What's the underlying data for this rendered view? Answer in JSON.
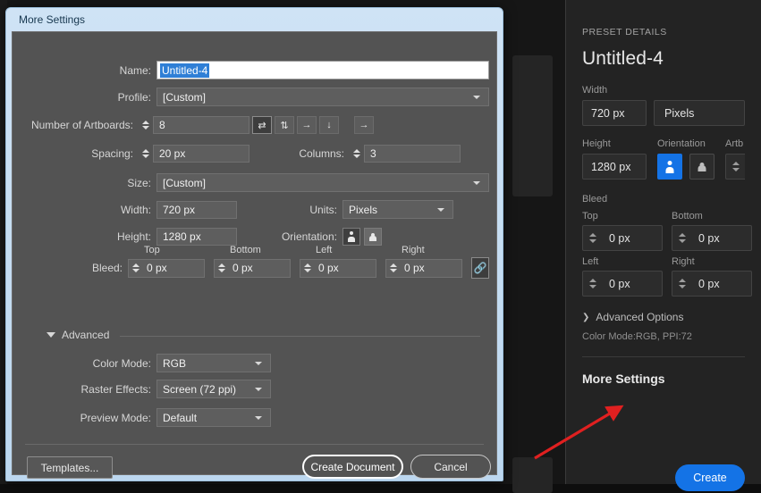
{
  "dialog": {
    "title": "More Settings",
    "fields": {
      "name_label": "Name:",
      "name_value": "Untitled-4",
      "profile_label": "Profile:",
      "profile_value": "[Custom]",
      "artboards_label": "Number of Artboards:",
      "artboards_value": "8",
      "spacing_label": "Spacing:",
      "spacing_value": "20 px",
      "columns_label": "Columns:",
      "columns_value": "3",
      "size_label": "Size:",
      "size_value": "[Custom]",
      "width_label": "Width:",
      "width_value": "720 px",
      "units_label": "Units:",
      "units_value": "Pixels",
      "height_label": "Height:",
      "height_value": "1280 px",
      "orientation_label": "Orientation:",
      "bleed_label": "Bleed:",
      "bleed_top_label": "Top",
      "bleed_top_value": "0 px",
      "bleed_bottom_label": "Bottom",
      "bleed_bottom_value": "0 px",
      "bleed_left_label": "Left",
      "bleed_left_value": "0 px",
      "bleed_right_label": "Right",
      "bleed_right_value": "0 px",
      "bleed_link_icon": "link-icon"
    },
    "artboard_arrangement_icons": [
      "grid-by-row-icon",
      "grid-by-column-icon",
      "arrange-by-row-icon",
      "arrange-by-column-icon",
      "change-to-right-to-left-layout-icon"
    ],
    "advanced": {
      "title": "Advanced",
      "color_mode_label": "Color Mode:",
      "color_mode_value": "RGB",
      "raster_effects_label": "Raster Effects:",
      "raster_effects_value": "Screen (72 ppi)",
      "preview_mode_label": "Preview Mode:",
      "preview_mode_value": "Default"
    },
    "buttons": {
      "templates": "Templates...",
      "create_document": "Create Document",
      "cancel": "Cancel"
    }
  },
  "preset_panel": {
    "heading": "PRESET DETAILS",
    "title": "Untitled-4",
    "width_label": "Width",
    "width_value": "720 px",
    "units_value": "Pixels",
    "height_label": "Height",
    "height_value": "1280 px",
    "orientation_label": "Orientation",
    "artboards_label": "Artb",
    "bleed_label": "Bleed",
    "bleed_top_label": "Top",
    "bleed_top_value": "0 px",
    "bleed_bottom_label": "Bottom",
    "bleed_bottom_value": "0 px",
    "bleed_left_label": "Left",
    "bleed_left_value": "0 px",
    "bleed_right_label": "Right",
    "bleed_right_value": "0 px",
    "advanced_options": "Advanced Options",
    "advanced_chevron": "chevron-right-icon",
    "color_mode_summary": "Color Mode:RGB, PPI:72",
    "more_settings": "More Settings",
    "create_button": "Create"
  },
  "colors": {
    "accent_blue": "#1473e6",
    "annotation_red": "#e02020",
    "titlebar_blue": "#cfe3f5",
    "dialog_gray": "#535353",
    "panel_gray": "#232323"
  },
  "annotation": {
    "type": "arrow",
    "target": "More Settings"
  }
}
